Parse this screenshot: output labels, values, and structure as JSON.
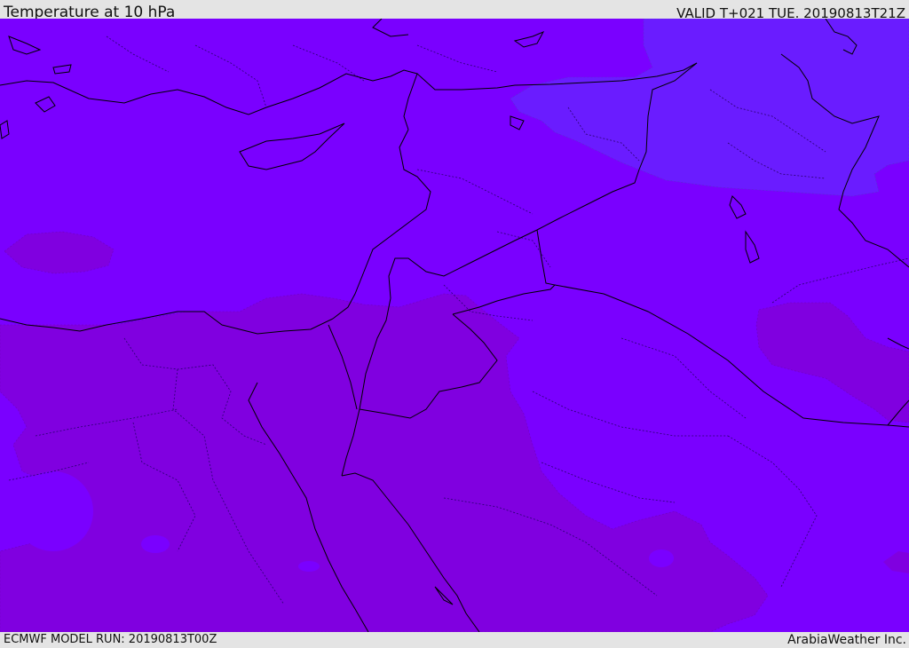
{
  "header": {
    "title": "Temperature at 10 hPa",
    "valid": "VALID T+021 TUE. 20190813T21Z"
  },
  "footer": {
    "model_run": "ECMWF MODEL RUN: 20190813T00Z",
    "brand": "ArabiaWeather Inc."
  },
  "colors": {
    "band_mid": "#7a00ff",
    "band_warm": "#8000e0",
    "band_cool": "#6a1cff",
    "coastline": "#000000"
  }
}
